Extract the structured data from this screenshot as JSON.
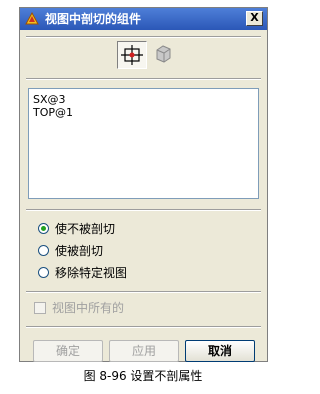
{
  "dialog": {
    "title": "视图中剖切的组件",
    "close_label": "X"
  },
  "toolbar": {
    "tools": [
      {
        "icon": "select-component-icon",
        "active": true
      },
      {
        "icon": "cube-icon",
        "active": false
      }
    ]
  },
  "component_list": [
    "SX@3",
    "TOP@1"
  ],
  "section_options": [
    {
      "label": "使不被剖切",
      "selected": true
    },
    {
      "label": "使被剖切",
      "selected": false
    },
    {
      "label": "移除特定视图",
      "selected": false
    }
  ],
  "all_in_view_label": "视图中所有的",
  "buttons": {
    "ok": "确定",
    "apply": "应用",
    "cancel": "取消"
  },
  "caption": "图 8-96   设置不剖属性"
}
